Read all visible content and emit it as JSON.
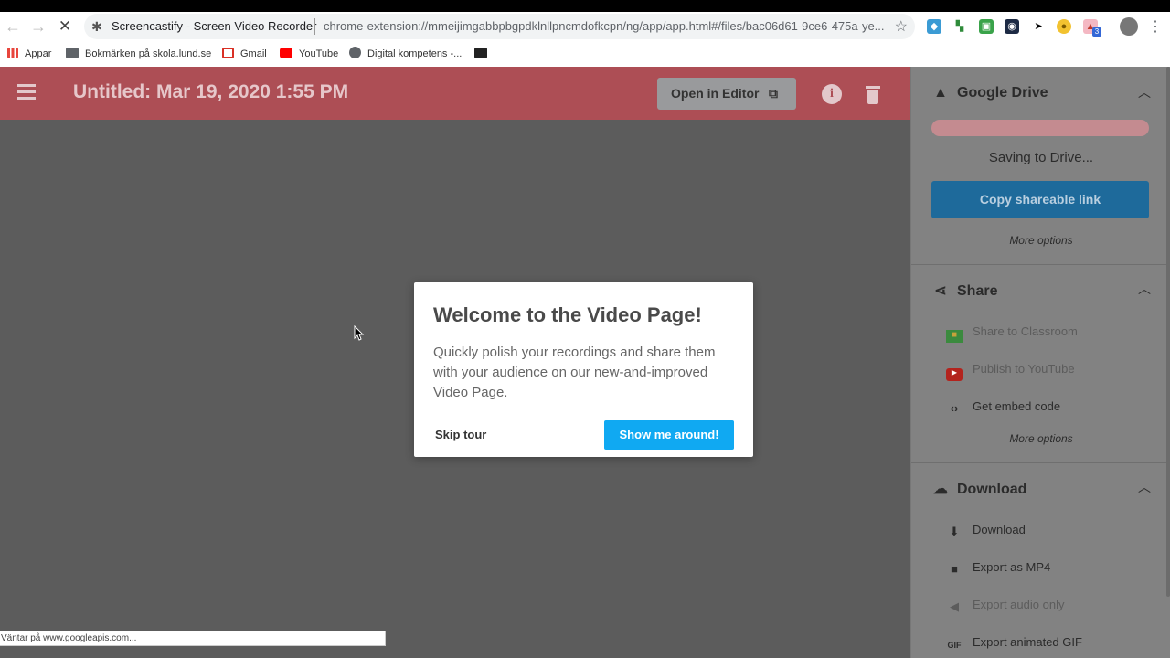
{
  "browser": {
    "tab_title": "Screencastify - Screen Video Recorder",
    "url": "chrome-extension://mmeijimgabbpbgpdklnllpncmdofkcpn/ng/app/app.html#/files/bac06d61-9ce6-475a-ye...",
    "bookmarks": [
      {
        "label": "Appar",
        "icon": "apps-grid-icon"
      },
      {
        "label": "Bokmärken på skola.lund.se",
        "icon": "folder-icon"
      },
      {
        "label": "Gmail",
        "icon": "gmail-icon"
      },
      {
        "label": "YouTube",
        "icon": "youtube-icon"
      },
      {
        "label": "Digital kompetens -...",
        "icon": "globe-icon"
      }
    ],
    "status": "Väntar på www.googleapis.com...",
    "extension_badge": "3"
  },
  "header": {
    "title": "Untitled: Mar 19, 2020 1:55 PM",
    "open_editor_label": "Open in Editor",
    "info_glyph": "i"
  },
  "panel": {
    "drive": {
      "title": "Google Drive",
      "saving_text": "Saving to Drive...",
      "copy_link_label": "Copy shareable link",
      "more_options": "More options"
    },
    "share": {
      "title": "Share",
      "items": [
        {
          "label": "Share to Classroom",
          "icon": "classroom-icon"
        },
        {
          "label": "Publish to YouTube",
          "icon": "youtube-icon"
        },
        {
          "label": "Get embed code",
          "icon": "code-icon"
        }
      ],
      "more_options": "More options"
    },
    "download": {
      "title": "Download",
      "items": [
        {
          "label": "Download",
          "icon": "download-icon"
        },
        {
          "label": "Export as MP4",
          "icon": "video-camera-icon"
        },
        {
          "label": "Export audio only",
          "icon": "speaker-icon"
        },
        {
          "label": "Export animated GIF",
          "icon": "gif-icon"
        }
      ]
    }
  },
  "modal": {
    "title": "Welcome to the Video Page!",
    "body": "Quickly polish your recordings and share them with your audience on our new-and-improved Video Page.",
    "skip_label": "Skip tour",
    "show_label": "Show me around!"
  },
  "colors": {
    "header_bg": "#ad4e55",
    "primary_button": "#10a9f2",
    "copy_button": "#1e6a9b"
  }
}
